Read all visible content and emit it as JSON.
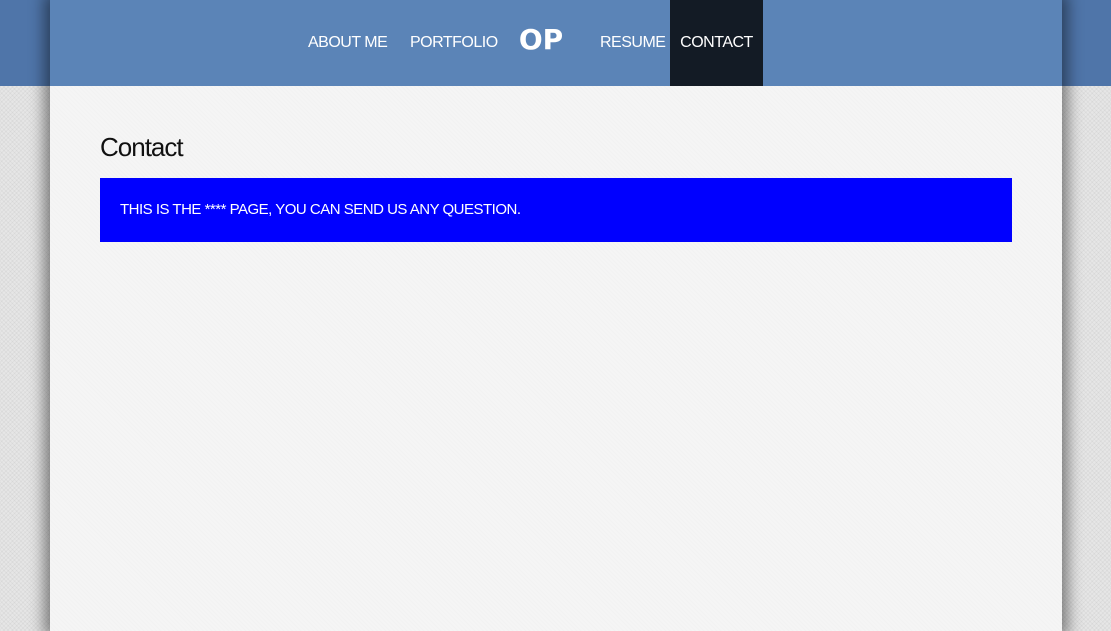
{
  "nav": {
    "about": "ABOUT ME",
    "portfolio": "PORTFOLIO",
    "logo": "OP",
    "resume": "RESUME",
    "contact": "CONTACT",
    "active": "contact"
  },
  "main": {
    "title": "Contact",
    "message": "THIS IS THE **** PAGE, YOU CAN SEND US ANY QUESTION."
  },
  "colors": {
    "navbar": "#5b84b7",
    "outer_bar": "#4f75a9",
    "active_nav": "#131b25",
    "message_box": "#0000ff",
    "page_background": "#f5f5f5"
  }
}
